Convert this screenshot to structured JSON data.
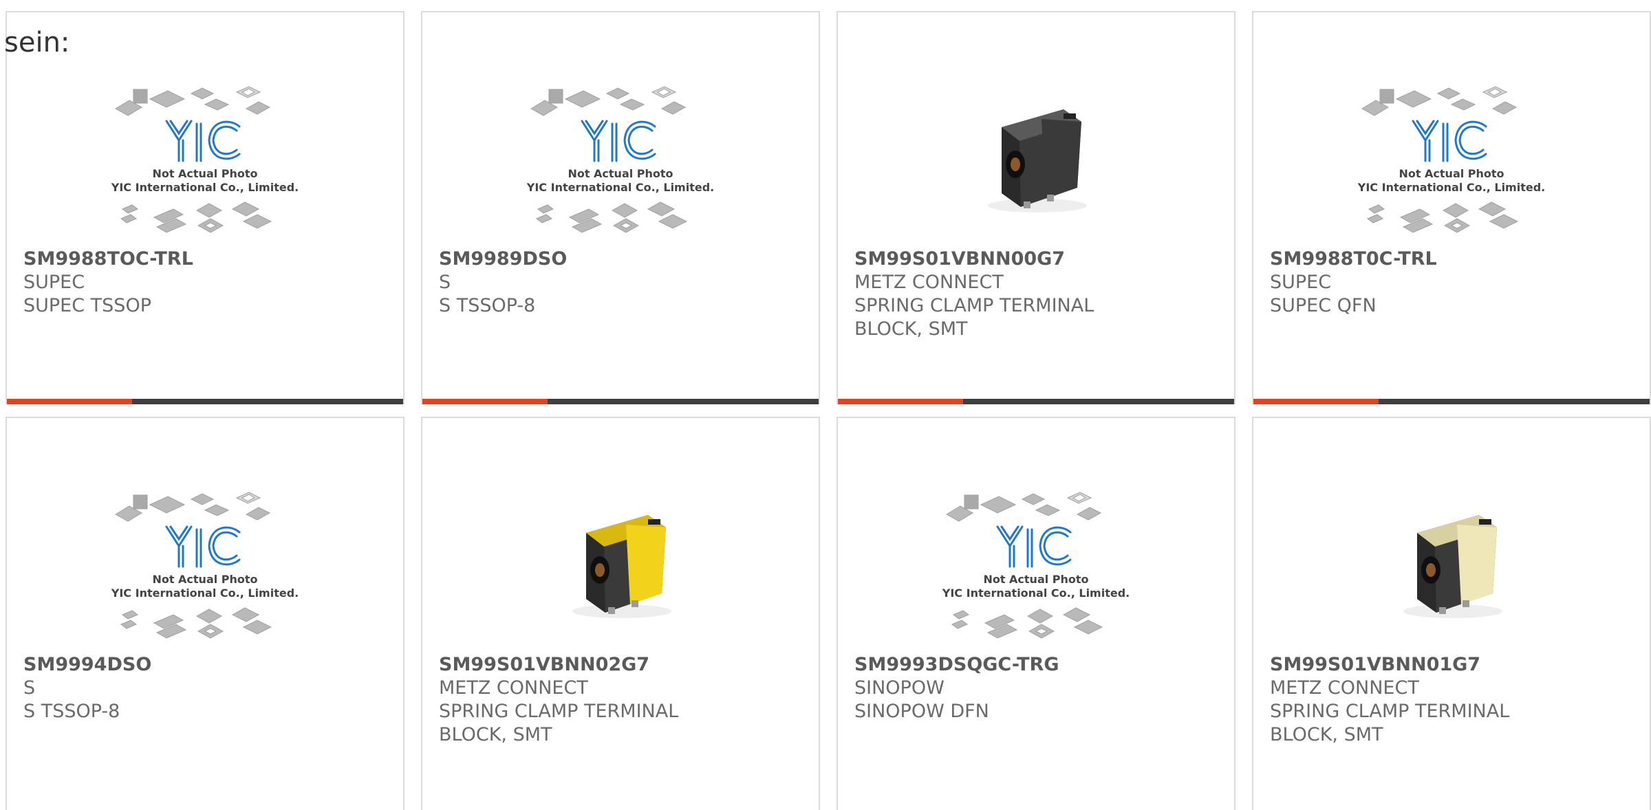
{
  "page": {
    "label": "sein:"
  },
  "colors": {
    "accent": "#e8401c",
    "bar_dark": "#3e3e3e",
    "yic_blue": "#1f78c8",
    "connector_yellow": "#f2d21b",
    "connector_ivory": "#efe7b8"
  },
  "placeholder": {
    "line1": "Not Actual Photo",
    "line2": "YIC International Co., Limited."
  },
  "products": [
    {
      "part_number": "SM9988TOC-TRL",
      "manufacturer": "SUPEC",
      "description": "SUPEC TSSOP",
      "image": "placeholder"
    },
    {
      "part_number": "SM9989DSO",
      "manufacturer": "S",
      "description": "S TSSOP-8",
      "image": "placeholder"
    },
    {
      "part_number": "SM99S01VBNN00G7",
      "manufacturer": "METZ CONNECT",
      "description": "SPRING CLAMP TERMINAL BLOCK, SMT",
      "image": "connector-black"
    },
    {
      "part_number": "SM9988T0C-TRL",
      "manufacturer": "SUPEC",
      "description": "SUPEC QFN",
      "image": "placeholder"
    },
    {
      "part_number": "SM9994DSO",
      "manufacturer": "S",
      "description": "S TSSOP-8",
      "image": "placeholder"
    },
    {
      "part_number": "SM99S01VBNN02G7",
      "manufacturer": "METZ CONNECT",
      "description": "SPRING CLAMP TERMINAL BLOCK, SMT",
      "image": "connector-yellow"
    },
    {
      "part_number": "SM9993DSQGC-TRG",
      "manufacturer": "SINOPOW",
      "description": "SINOPOW DFN",
      "image": "placeholder"
    },
    {
      "part_number": "SM99S01VBNN01G7",
      "manufacturer": "METZ CONNECT",
      "description": "SPRING CLAMP TERMINAL BLOCK, SMT",
      "image": "connector-ivory"
    }
  ]
}
